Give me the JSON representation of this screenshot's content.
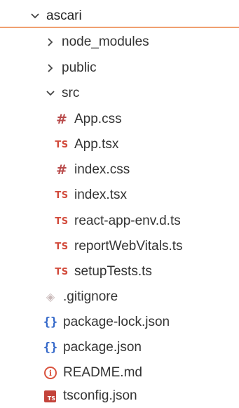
{
  "explorer": {
    "root": {
      "label": "ascari",
      "chevron_icon": "chevron-down-icon"
    },
    "folders": {
      "node_modules": {
        "label": "node_modules",
        "chevron_icon": "chevron-right-icon"
      },
      "public": {
        "label": "public",
        "chevron_icon": "chevron-right-icon"
      },
      "src": {
        "label": "src",
        "chevron_icon": "chevron-down-icon"
      }
    },
    "src_files": [
      {
        "label": "App.css",
        "icon": "css-file-icon",
        "glyph": "#"
      },
      {
        "label": "App.tsx",
        "icon": "typescript-file-icon",
        "glyph": "TS"
      },
      {
        "label": "index.css",
        "icon": "css-file-icon",
        "glyph": "#"
      },
      {
        "label": "index.tsx",
        "icon": "typescript-file-icon",
        "glyph": "TS"
      },
      {
        "label": "react-app-env.d.ts",
        "icon": "typescript-file-icon",
        "glyph": "TS"
      },
      {
        "label": "reportWebVitals.ts",
        "icon": "typescript-file-icon",
        "glyph": "TS"
      },
      {
        "label": "setupTests.ts",
        "icon": "typescript-file-icon",
        "glyph": "TS"
      }
    ],
    "root_files": [
      {
        "label": ".gitignore",
        "icon": "git-file-icon",
        "glyph": "◈"
      },
      {
        "label": "package-lock.json",
        "icon": "json-file-icon",
        "glyph": "{}"
      },
      {
        "label": "package.json",
        "icon": "json-file-icon",
        "glyph": "{}"
      },
      {
        "label": "README.md",
        "icon": "info-icon",
        "glyph": "i"
      },
      {
        "label": "tsconfig.json",
        "icon": "tsconfig-file-icon",
        "glyph": "TS"
      }
    ]
  },
  "colors": {
    "selection_border": "#f0a070",
    "css_icon": "#b84a4a",
    "ts_icon": "#d24b3c",
    "json_icon": "#3468c9",
    "info_icon": "#d9533e",
    "git_icon": "#c9b9b9"
  }
}
